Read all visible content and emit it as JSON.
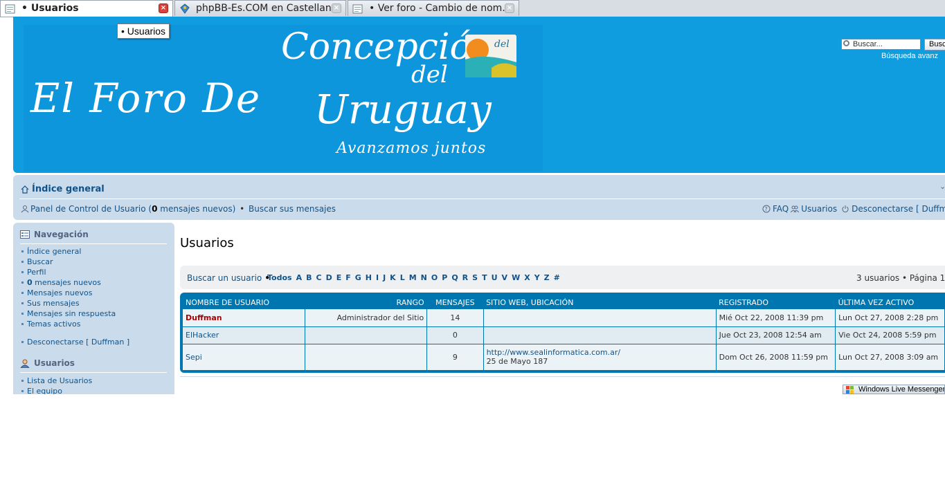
{
  "browser": {
    "tabs": [
      {
        "title": "• Usuarios",
        "active": true
      },
      {
        "title": "phpBB-Es.COM en Castellan...",
        "active": false
      },
      {
        "title": "• Ver foro - Cambio de nom...",
        "active": false
      }
    ],
    "tooltip": "• Usuarios"
  },
  "header": {
    "banner_line1": "El Foro De",
    "banner_line2": "Concepción",
    "banner_line3": "del",
    "banner_line4": "Uruguay",
    "banner_slogan": "Avanzamos juntos",
    "logo_text": "del",
    "search_placeholder": "Buscar...",
    "search_button": "Busc",
    "advanced_search": "Búsqueda avanz"
  },
  "navbar": {
    "index_link": "Índice general",
    "ucp_prefix": "Panel de Control de Usuario (",
    "ucp_count": "0",
    "ucp_suffix": " mensajes nuevos)",
    "separator": " • ",
    "search_own": "Buscar sus mensajes",
    "faq": "FAQ",
    "members": "Usuarios",
    "logout": "Desconectarse [ Duffm"
  },
  "sidebar": {
    "nav_title": "Navegación",
    "nav_items": [
      "Índice general",
      "Buscar",
      "Perfil",
      "mensajes nuevos",
      "Mensajes nuevos",
      "Sus mensajes",
      "Mensajes sin respuesta",
      "Temas activos"
    ],
    "nav_new_count": "0",
    "logout_item": "Desconectarse [ Duffman ]",
    "users_title": "Usuarios",
    "users_items": [
      "Lista de Usuarios",
      "El equipo"
    ]
  },
  "main": {
    "title": "Usuarios",
    "filter_label": "Buscar un usuario",
    "filter_bullet": " • ",
    "letters": [
      "Todos",
      "A",
      "B",
      "C",
      "D",
      "E",
      "F",
      "G",
      "H",
      "I",
      "J",
      "K",
      "L",
      "M",
      "N",
      "O",
      "P",
      "Q",
      "R",
      "S",
      "T",
      "U",
      "V",
      "W",
      "X",
      "Y",
      "Z",
      "#"
    ],
    "pager": "3 usuarios • Página 1 d",
    "columns": [
      "NOMBRE DE USUARIO",
      "RANGO",
      "MENSAJES",
      "SITIO WEB, UBICACIÓN",
      "REGISTRADO",
      "ÚLTIMA VEZ ACTIVO"
    ],
    "rows": [
      {
        "name": "Duffman",
        "rank": "Administrador del Sitio",
        "posts": "14",
        "website": "",
        "location": "",
        "registered": "Mié Oct 22, 2008 11:39 pm",
        "last_active": "Lun Oct 27, 2008 2:28 pm"
      },
      {
        "name": "ElHacker",
        "rank": "",
        "posts": "0",
        "website": "",
        "location": "",
        "registered": "Jue Oct 23, 2008 12:54 am",
        "last_active": "Vie Oct 24, 2008 5:59 pm"
      },
      {
        "name": "Sepi",
        "rank": "",
        "posts": "9",
        "website": "http://www.sealinformatica.com.ar/",
        "location": "25 de Mayo 187",
        "registered": "Dom Oct 26, 2008 11:59 pm",
        "last_active": "Lun Oct 27, 2008 3:09 am"
      }
    ]
  },
  "taskbar": {
    "messenger": "Windows Live Messenger"
  },
  "colors": {
    "header_blue": "#0f9de0",
    "nav_bg": "#cadceb",
    "link": "#105289",
    "table_head": "#0076b1",
    "admin_red": "#aa0000"
  }
}
